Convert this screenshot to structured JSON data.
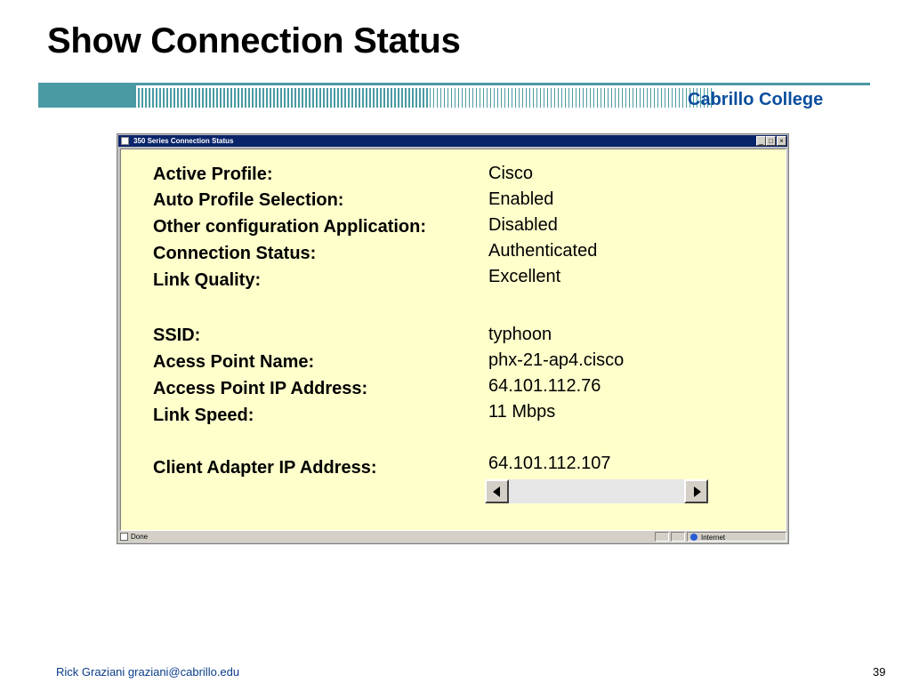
{
  "slide": {
    "title": "Show Connection Status",
    "college": "Cabrillo College",
    "footer_author": "Rick Graziani  graziani@cabrillo.edu",
    "page_number": "39",
    "brand_color": "#0a4e9e",
    "banner_color": "#4a9aa4"
  },
  "window": {
    "title": "350 Series Connection Status",
    "minimize_label": "_",
    "maximize_label": "□",
    "close_label": "×",
    "content_background": "#ffffcc"
  },
  "status": {
    "active_profile": {
      "label": "Active Profile:",
      "value": "Cisco"
    },
    "auto_profile": {
      "label": "Auto Profile Selection:",
      "value": "Enabled"
    },
    "other_config": {
      "label": "Other configuration Application:",
      "value": "Disabled"
    },
    "connection_status": {
      "label": "Connection Status:",
      "value": "Authenticated"
    },
    "link_quality": {
      "label": "Link Quality:",
      "value": "Excellent"
    },
    "ssid": {
      "label": "SSID:",
      "value": "typhoon"
    },
    "ap_name": {
      "label": "Acess Point Name:",
      "value": "phx-21-ap4.cisco"
    },
    "ap_ip": {
      "label": "Access Point  IP Address:",
      "value": "64.101.112.76"
    },
    "link_speed": {
      "label": "Link Speed:",
      "value": "11 Mbps"
    },
    "client_ip": {
      "label": "Client Adapter IP Address:",
      "value": "64.101.112.107"
    }
  },
  "statusbar": {
    "left_text": "Done",
    "zone_text": "Internet",
    "zone_icon": "globe-icon"
  }
}
